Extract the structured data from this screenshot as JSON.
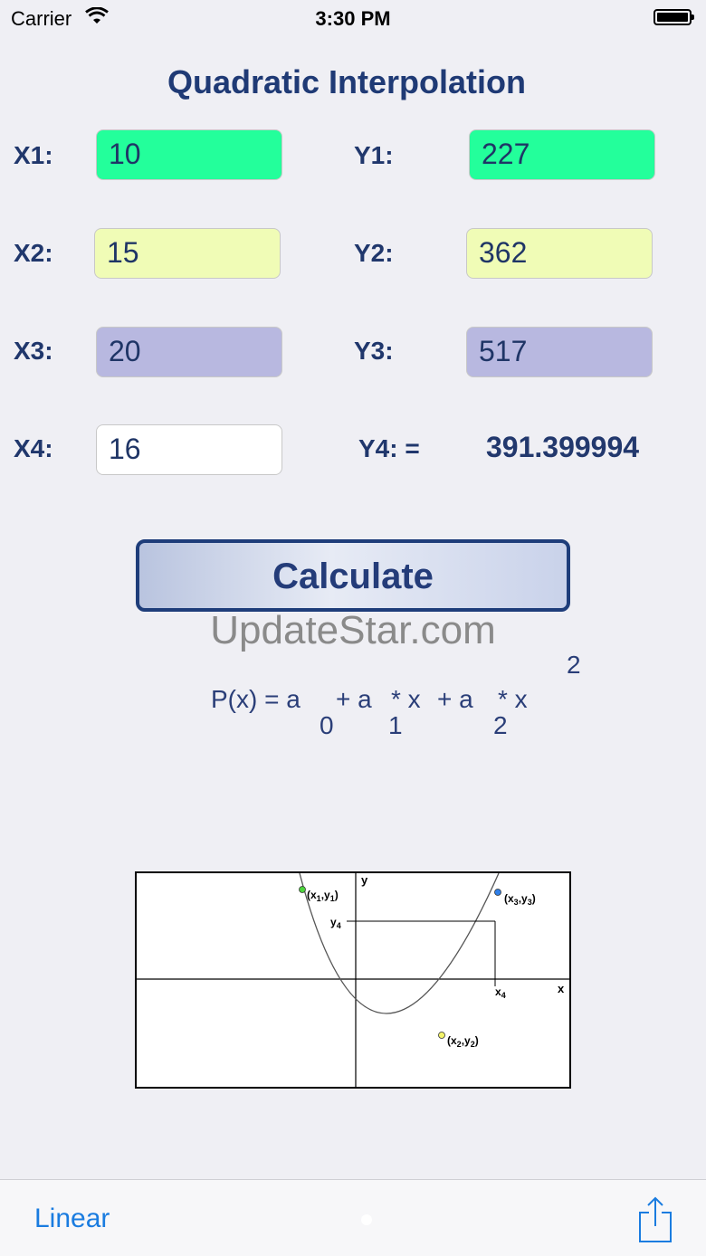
{
  "status_bar": {
    "carrier": "Carrier",
    "time": "3:30 PM",
    "wifi_icon": "wifi-icon",
    "battery_icon": "battery-icon"
  },
  "title": "Quadratic Interpolation",
  "inputs": {
    "x1": {
      "label": "X1:",
      "value": "10",
      "color": "#23ff9b"
    },
    "y1": {
      "label": "Y1:",
      "value": "227",
      "color": "#23ff9b"
    },
    "x2": {
      "label": "X2:",
      "value": "15",
      "color": "#f0fcb6"
    },
    "y2": {
      "label": "Y2:",
      "value": "362",
      "color": "#f0fcb6"
    },
    "x3": {
      "label": "X3:",
      "value": "20",
      "color": "#b8b8e0"
    },
    "y3": {
      "label": "Y3:",
      "value": "517",
      "color": "#b8b8e0"
    },
    "x4": {
      "label": "X4:",
      "value": "16",
      "color": "#ffffff"
    }
  },
  "output": {
    "label": "Y4: =",
    "value": "391.399994"
  },
  "calculate_button": "Calculate",
  "watermark": "UpdateStar.com",
  "formula": {
    "main": "P(x) = a",
    "plus1": "+ a",
    "times1": "* x",
    "plus2": "+ a",
    "times2": "* x",
    "sub0": "0",
    "sub1": "1",
    "sub2": "2",
    "superscript": "2"
  },
  "diagram": {
    "axis_x": "x",
    "axis_y": "y",
    "p1": "(x",
    "p1_sub": "1",
    "p1_mid": ",y",
    "p1_sub2": "1",
    "p2": "(x",
    "p2_sub": "2",
    "p2_mid": ",y",
    "p2_sub2": "2",
    "p3": "(x",
    "p3_sub": "3",
    "p3_mid": ",y",
    "p3_sub2": "3",
    "close": ")",
    "y4": "y",
    "y4_sub": "4",
    "x4": "x",
    "x4_sub": "4",
    "point_colors": [
      "#4cd43c",
      "#f4f46a",
      "#2f7fe8"
    ]
  },
  "toolbar": {
    "linear": "Linear",
    "share_icon": "share-icon"
  }
}
